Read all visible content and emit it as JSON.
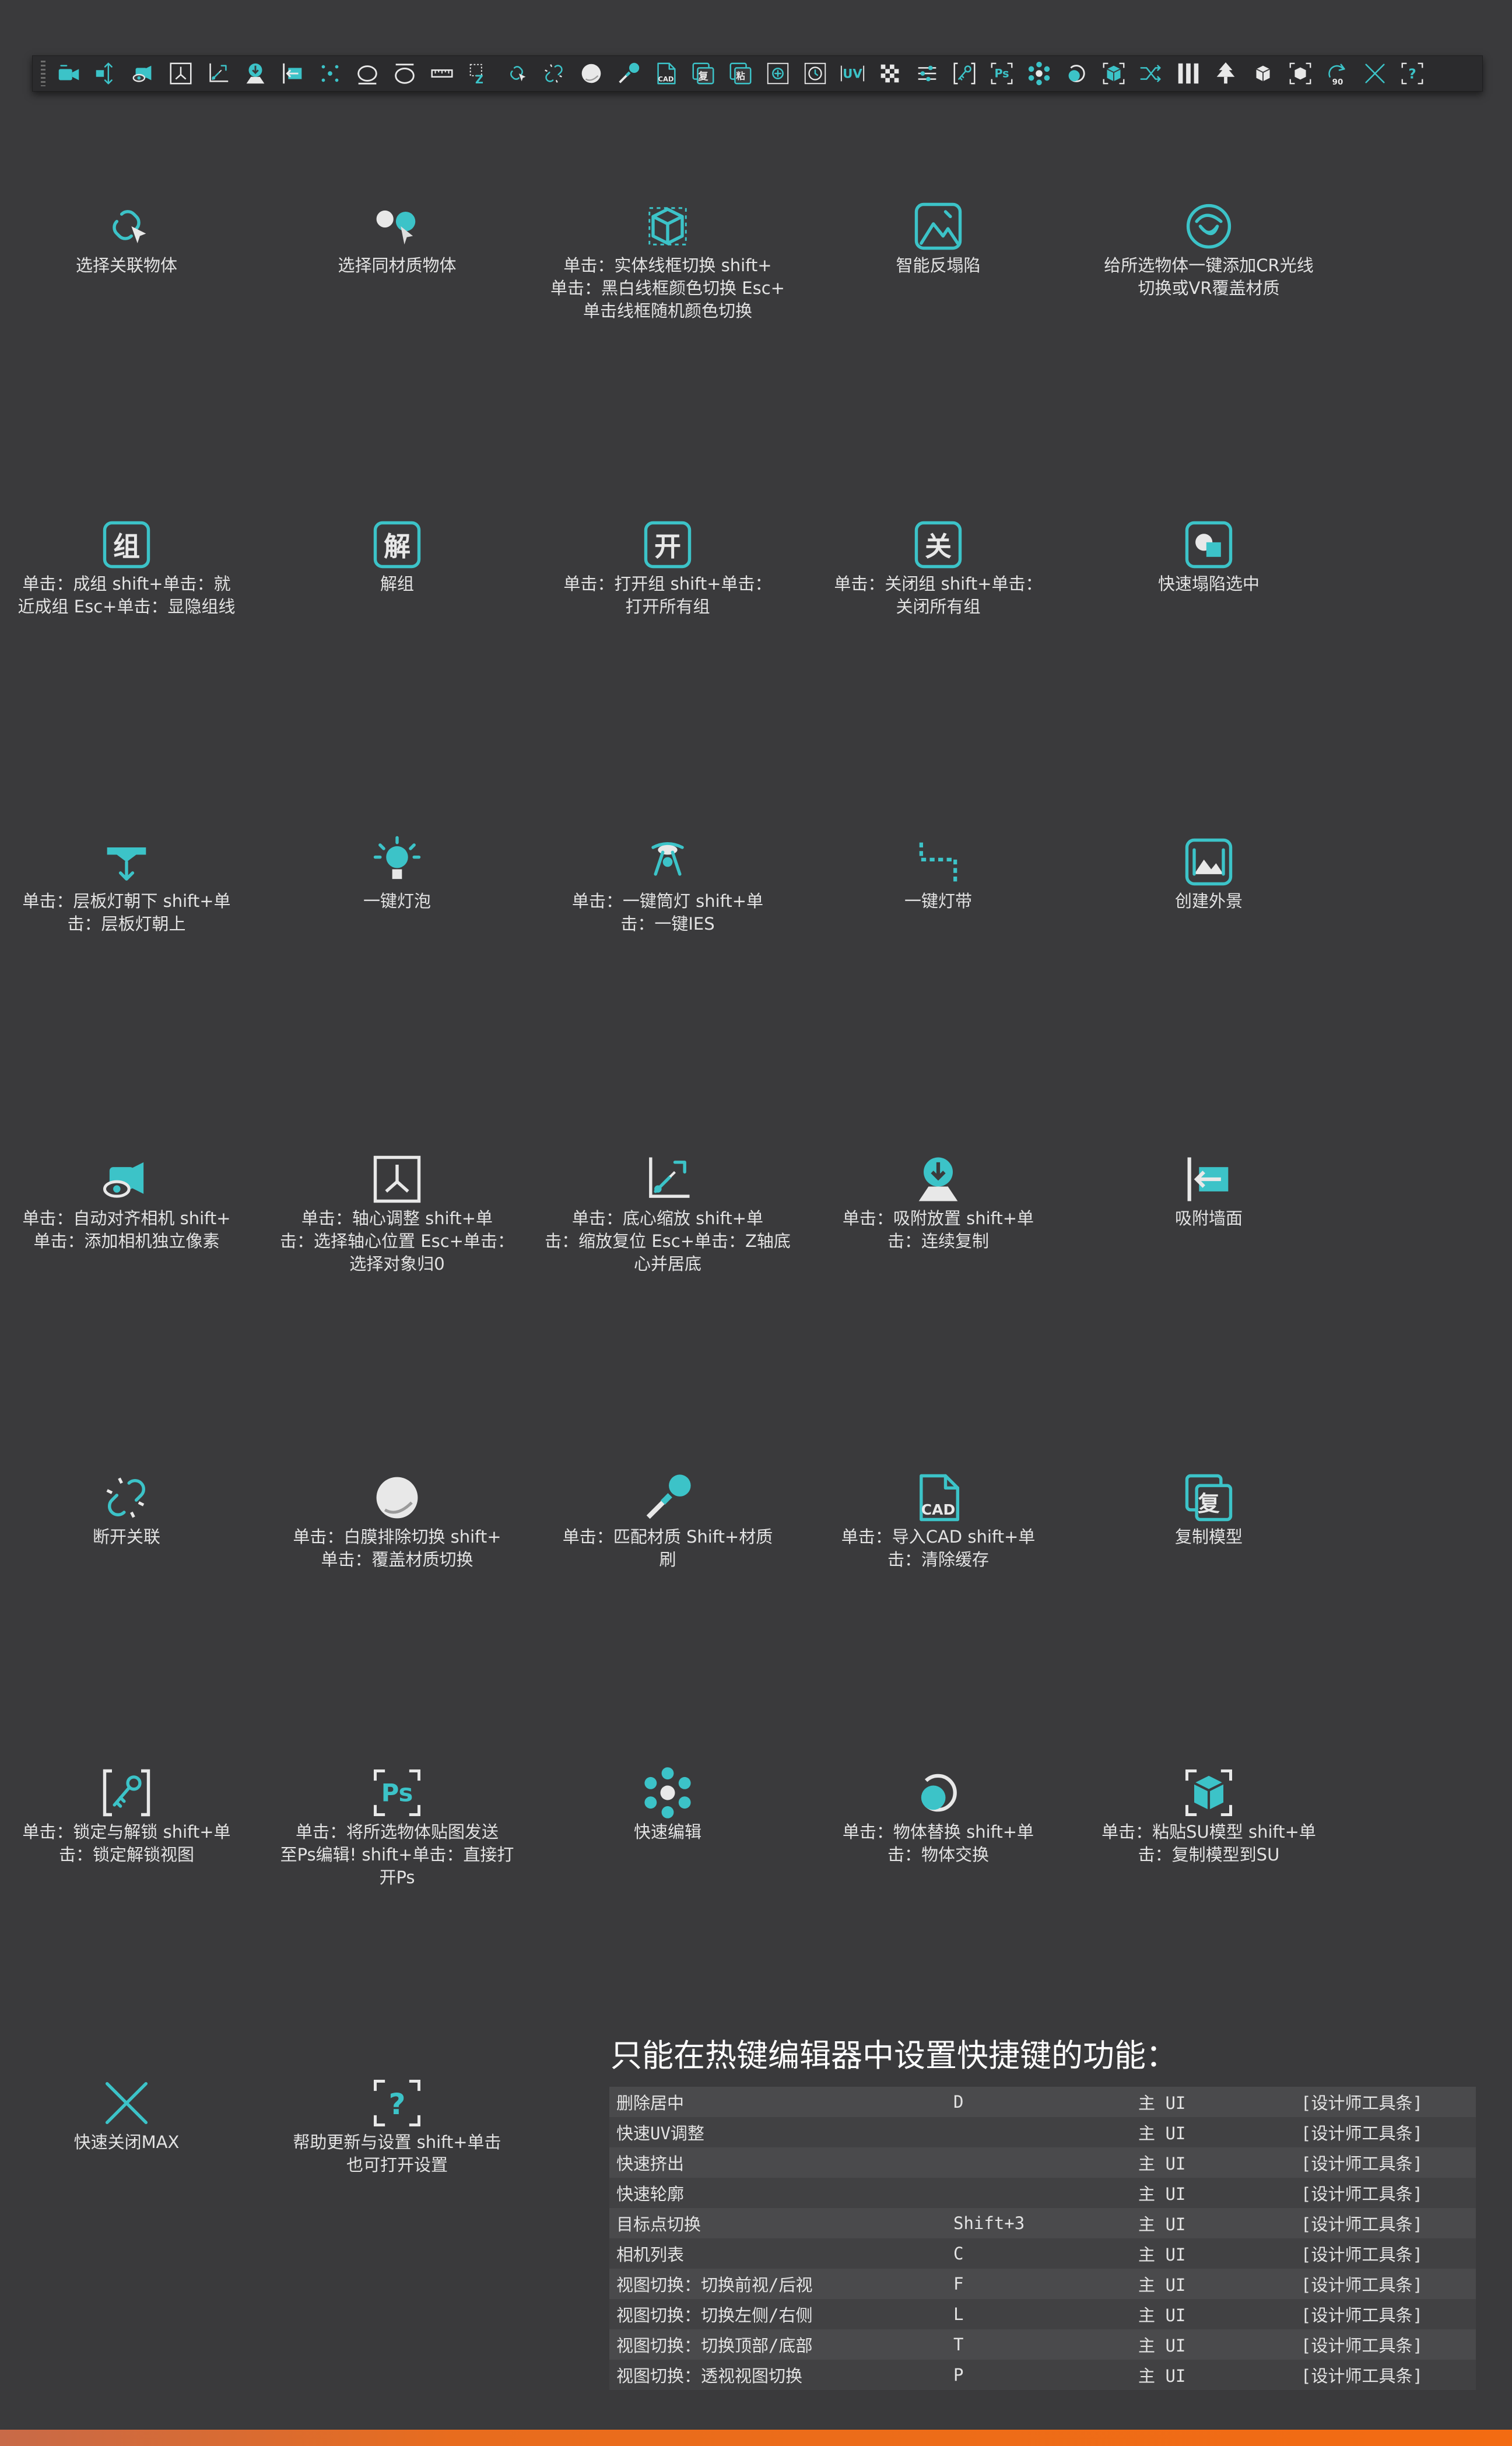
{
  "toolbar": {
    "icons": [
      "camera-align-icon",
      "pivot-adjust-icon",
      "camera-eye-icon",
      "axis-frame-icon",
      "base-scale-icon",
      "snap-place-icon",
      "snap-wall-icon",
      "scatter-icon",
      "ellipse-icon",
      "ellipse-flat-icon",
      "ruler-icon",
      "grid-z-icon",
      "select-linked-icon",
      "unlink-icon",
      "sphere-material-icon",
      "match-material-icon",
      "import-cad-icon",
      "copy-model-icon",
      "paste-model-icon",
      "add-circle-icon",
      "clock-circle-icon",
      "uv-icon",
      "checker-icon",
      "sliders-icon",
      "lock-key-icon",
      "photoshop-icon",
      "quick-edit-icon",
      "replace-object-icon",
      "paste-su-icon",
      "shuffle-icon",
      "columns-icon",
      "tree-icon",
      "cube-small-icon",
      "cube-frame-icon",
      "rotate-90-icon",
      "close-max-icon",
      "help-icon"
    ],
    "rotate_label": "90",
    "cad_label": "CAD",
    "copy_label": "复",
    "paste_label": "粘",
    "uv_label": "UV",
    "ps_label": "Ps"
  },
  "grid": [
    {
      "icon": "select-linked-icon",
      "label": "选择关联物体"
    },
    {
      "icon": "same-material-icon",
      "label": "选择同材质物体"
    },
    {
      "icon": "wireframe-box-icon",
      "label": "单击：实体线框切换 shift+\n单击：黑白线框颜色切换 Esc+\n单击线框随机颜色切换"
    },
    {
      "icon": "smart-collapse-icon",
      "label": "智能反塌陷"
    },
    {
      "icon": "cr-light-icon",
      "label": "给所选物体一键添加CR光线\n切换或VR覆盖材质"
    },
    {
      "icon": "group-icon",
      "glyph": "组",
      "label": "单击：成组 shift+单击：就\n近成组 Esc+单击：显隐组线"
    },
    {
      "icon": "ungroup-icon",
      "glyph": "解",
      "label": "解组"
    },
    {
      "icon": "open-group-icon",
      "glyph": "开",
      "label": "单击：打开组 shift+单击：\n打开所有组"
    },
    {
      "icon": "close-group-icon",
      "glyph": "关",
      "label": "单击：关闭组 shift+单击：\n关闭所有组"
    },
    {
      "icon": "quick-collapse-icon",
      "label": "快速塌陷选中"
    },
    {
      "icon": "shelf-light-icon",
      "label": "单击：层板灯朝下 shift+单\n击：层板灯朝上"
    },
    {
      "icon": "bulb-icon",
      "label": "一键灯泡"
    },
    {
      "icon": "spotlight-icon",
      "label": "单击：一键筒灯 shift+单\n击：一键IES"
    },
    {
      "icon": "light-strip-icon",
      "label": "一键灯带"
    },
    {
      "icon": "exterior-icon",
      "label": "创建外景"
    },
    {
      "icon": "camera-eye-icon",
      "label": "单击：自动对齐相机 shift+\n单击：添加相机独立像素"
    },
    {
      "icon": "axis-frame-icon",
      "label": "单击：轴心调整 shift+单\n击：选择轴心位置 Esc+单击：\n选择对象归0"
    },
    {
      "icon": "base-scale-icon",
      "label": "单击：底心缩放 shift+单\n击：缩放复位 Esc+单击：Z轴底\n心并居底"
    },
    {
      "icon": "snap-place-icon",
      "label": "单击：吸附放置 shift+单\n击：连续复制"
    },
    {
      "icon": "snap-wall-icon",
      "label": "吸附墙面"
    },
    {
      "icon": "unlink-icon",
      "label": "断开关联"
    },
    {
      "icon": "sphere-material-icon",
      "label": "单击：白膜排除切换 shift+\n单击：覆盖材质切换"
    },
    {
      "icon": "match-material-icon",
      "label": "单击：匹配材质 Shift+材质\n刷"
    },
    {
      "icon": "import-cad-icon",
      "label": "单击：导入CAD shift+单\n击：清除缓存"
    },
    {
      "icon": "copy-model-icon",
      "glyph": "复",
      "label": "复制模型"
    },
    {
      "icon": "lock-key-icon",
      "label": "单击：锁定与解锁 shift+单\n击：锁定解锁视图"
    },
    {
      "icon": "photoshop-icon",
      "label": "单击：将所选物体贴图发送\n至Ps编辑! shift+单击：直接打\n开Ps"
    },
    {
      "icon": "quick-edit-icon",
      "label": "快速编辑"
    },
    {
      "icon": "replace-object-icon",
      "label": "单击：物体替换 shift+单\n击：物体交换"
    },
    {
      "icon": "paste-su-icon",
      "label": "单击：粘贴SU模型 shift+单\n击：复制模型到SU"
    },
    {
      "icon": "close-max-icon",
      "label": "快速关闭MAX"
    },
    {
      "icon": "help-icon",
      "label": "帮助更新与设置 shift+单击\n也可打开设置"
    }
  ],
  "hotkeys": {
    "title": "只能在热键编辑器中设置快捷键的功能：",
    "rows": [
      [
        "删除居中",
        "D",
        "主 UI",
        "[设计师工具条]"
      ],
      [
        "快速UV调整",
        "",
        "主 UI",
        "[设计师工具条]"
      ],
      [
        "快速挤出",
        "",
        "主 UI",
        "[设计师工具条]"
      ],
      [
        "快速轮廓",
        "",
        "主 UI",
        "[设计师工具条]"
      ],
      [
        "目标点切换",
        "Shift+3",
        "主 UI",
        "[设计师工具条]"
      ],
      [
        "相机列表",
        "C",
        "主 UI",
        "[设计师工具条]"
      ],
      [
        "视图切换：切换前视/后视",
        "F",
        "主 UI",
        "[设计师工具条]"
      ],
      [
        "视图切换：切换左侧/右侧",
        "L",
        "主 UI",
        "[设计师工具条]"
      ],
      [
        "视图切换：切换顶部/底部",
        "T",
        "主 UI",
        "[设计师工具条]"
      ],
      [
        "视图切换：透视视图切换",
        "P",
        "主 UI",
        "[设计师工具条]"
      ]
    ]
  },
  "colors": {
    "accent": "#3cc3c8",
    "bottom_bar": "#f36b12"
  }
}
